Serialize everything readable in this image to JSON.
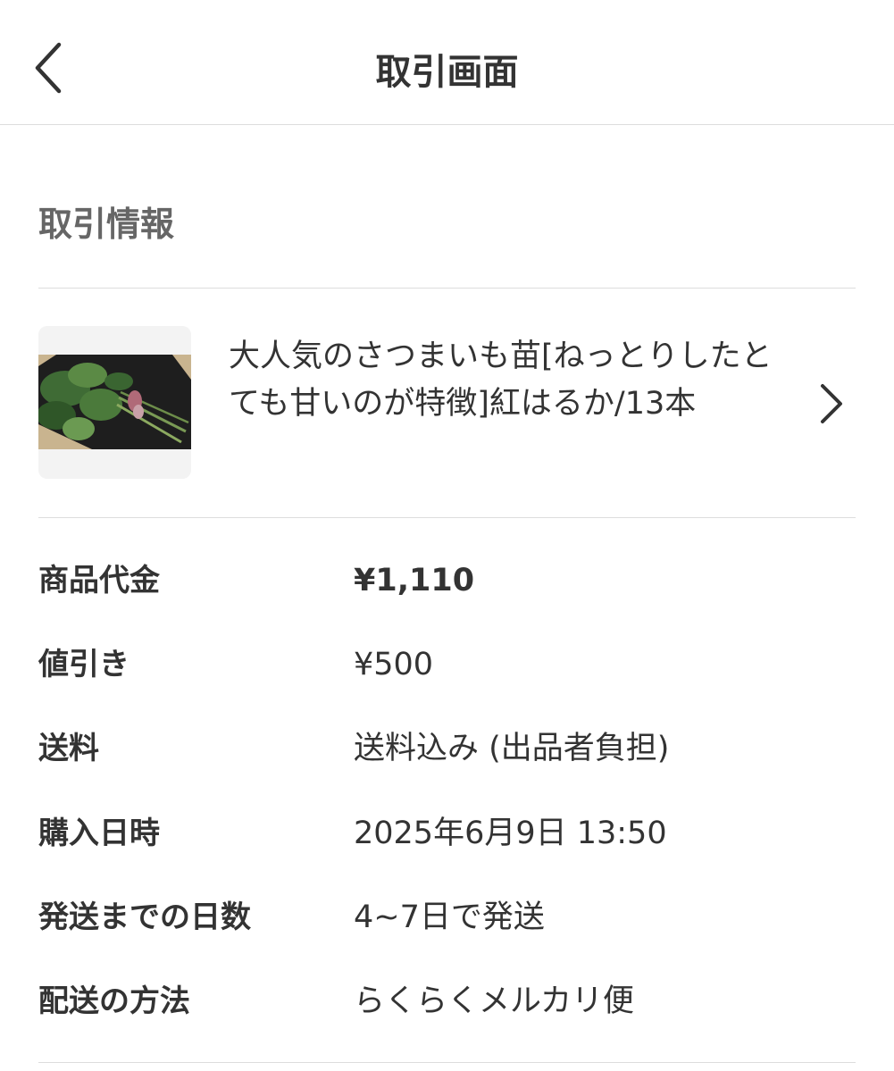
{
  "header": {
    "title": "取引画面",
    "back_icon": "chevron-left-icon"
  },
  "section": {
    "title": "取引情報"
  },
  "item": {
    "title": "大人気のさつまいも苗[ねっとりしたとても甘いのが特徴]紅はるか/13本",
    "thumbnail": "sweet-potato-seedlings-photo",
    "chevron_icon": "chevron-right-icon"
  },
  "details": {
    "price": {
      "label": "商品代金",
      "value": "¥1,110"
    },
    "discount": {
      "label": "値引き",
      "value": "¥500"
    },
    "shipping_fee": {
      "label": "送料",
      "value": "送料込み (出品者負担)"
    },
    "purchase_date": {
      "label": "購入日時",
      "value": "2025年6月9日 13:50"
    },
    "days_to_ship": {
      "label": "発送までの日数",
      "value": "4~7日で発送"
    },
    "shipping_method": {
      "label": "配送の方法",
      "value": "らくらくメルカリ便"
    }
  },
  "colors": {
    "text": "#333333",
    "section_title": "#666666",
    "divider": "#dddddd"
  }
}
